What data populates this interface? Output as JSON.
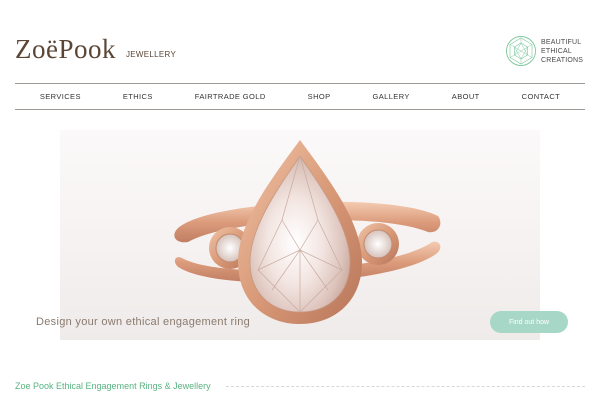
{
  "header": {
    "logo_text": "ZoëPook",
    "logo_subtitle": "JEWELLERY",
    "badge_lines": [
      "BEAUTIFUL",
      "ETHICAL",
      "CREATIONS"
    ],
    "badge_icon": "diamond-facet-icon"
  },
  "nav": {
    "items": [
      "SERVICES",
      "ETHICS",
      "FAIRTRADE GOLD",
      "SHOP",
      "GALLERY",
      "ABOUT",
      "CONTACT"
    ]
  },
  "hero": {
    "image": "rose-gold-pear-diamond-ring",
    "caption": "Design your own ethical engagement ring",
    "cta_label": "Find out how"
  },
  "section": {
    "title": "Zoe Pook Ethical Engagement Rings & Jewellery"
  },
  "colors": {
    "brand_brown": "#5b4636",
    "accent_green": "#59b381",
    "cta_mint": "#a7d7c7"
  }
}
